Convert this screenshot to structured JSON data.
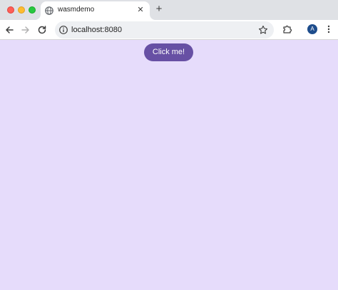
{
  "browser": {
    "tab": {
      "title": "wasmdemo",
      "favicon": "globe-icon",
      "close_glyph": "✕"
    },
    "new_tab_glyph": "+",
    "address_bar": {
      "url": "localhost:8080"
    },
    "profile_initial": "A",
    "colors": {
      "avatar": "#1e4d8c",
      "page_background": "#e6dcfb"
    }
  },
  "page": {
    "button_label": "Click me!",
    "colors": {
      "button_background": "#6750a4",
      "button_text": "#ffffff"
    }
  }
}
